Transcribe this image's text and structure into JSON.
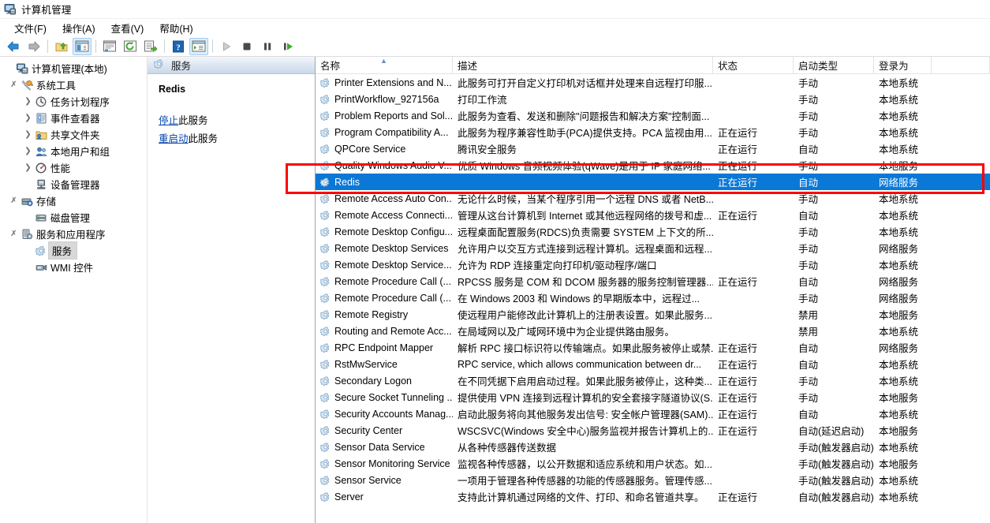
{
  "window": {
    "title": "计算机管理",
    "icon": "computer-management-icon"
  },
  "menu": {
    "items": [
      {
        "label": "文件(F)",
        "text": "文件",
        "accel": "F"
      },
      {
        "label": "操作(A)",
        "text": "操作",
        "accel": "A"
      },
      {
        "label": "查看(V)",
        "text": "查看",
        "accel": "V"
      },
      {
        "label": "帮助(H)",
        "text": "帮助",
        "accel": "H"
      }
    ]
  },
  "toolbar": {
    "buttons": [
      {
        "name": "back-icon",
        "title": "后退"
      },
      {
        "name": "forward-icon",
        "title": "前进"
      },
      {
        "name": "up-folder-icon",
        "title": "上移一级"
      },
      {
        "name": "show-hide-tree-icon",
        "title": "显示/隐藏控制台树",
        "active": true
      },
      {
        "name": "properties-icon",
        "title": "属性"
      },
      {
        "name": "refresh-icon",
        "title": "刷新"
      },
      {
        "name": "export-list-icon",
        "title": "导出列表"
      },
      {
        "name": "help-icon",
        "title": "帮助"
      },
      {
        "name": "show-action-pane-icon",
        "title": "显示/隐藏操作窗格",
        "active": true
      },
      {
        "name": "start-service-icon",
        "title": "启动服务"
      },
      {
        "name": "stop-service-icon",
        "title": "停止服务"
      },
      {
        "name": "pause-service-icon",
        "title": "暂停服务"
      },
      {
        "name": "restart-service-icon",
        "title": "重新启动服务"
      }
    ]
  },
  "sidebar": {
    "items": [
      {
        "label": "计算机管理(本地)",
        "depth": 0,
        "twist": "",
        "icon": "computer-icon",
        "selected": false
      },
      {
        "label": "系统工具",
        "depth": 1,
        "twist": "v",
        "icon": "system-tools-icon",
        "selected": false
      },
      {
        "label": "任务计划程序",
        "depth": 2,
        "twist": ">",
        "icon": "task-scheduler-icon",
        "selected": false
      },
      {
        "label": "事件查看器",
        "depth": 2,
        "twist": ">",
        "icon": "event-viewer-icon",
        "selected": false
      },
      {
        "label": "共享文件夹",
        "depth": 2,
        "twist": ">",
        "icon": "shared-folders-icon",
        "selected": false
      },
      {
        "label": "本地用户和组",
        "depth": 2,
        "twist": ">",
        "icon": "local-users-icon",
        "selected": false
      },
      {
        "label": "性能",
        "depth": 2,
        "twist": ">",
        "icon": "performance-icon",
        "selected": false
      },
      {
        "label": "设备管理器",
        "depth": 2,
        "twist": "",
        "icon": "device-manager-icon",
        "selected": false
      },
      {
        "label": "存储",
        "depth": 1,
        "twist": "v",
        "icon": "storage-icon",
        "selected": false
      },
      {
        "label": "磁盘管理",
        "depth": 2,
        "twist": "",
        "icon": "disk-management-icon",
        "selected": false
      },
      {
        "label": "服务和应用程序",
        "depth": 1,
        "twist": "v",
        "icon": "services-apps-icon",
        "selected": false
      },
      {
        "label": "服务",
        "depth": 2,
        "twist": "",
        "icon": "service-gear-icon",
        "selected": true
      },
      {
        "label": "WMI 控件",
        "depth": 2,
        "twist": "",
        "icon": "wmi-control-icon",
        "selected": false
      }
    ]
  },
  "details": {
    "header_title": "服务",
    "header_icon": "service-gear-icon",
    "service_name": "Redis",
    "links": [
      {
        "link_text": "停止",
        "rest_text": "此服务"
      },
      {
        "link_text": "重启动",
        "rest_text": "此服务"
      }
    ]
  },
  "list": {
    "columns": [
      {
        "key": "name",
        "label": "名称",
        "sorted": true,
        "sort_dir": "asc"
      },
      {
        "key": "desc",
        "label": "描述",
        "sorted": false
      },
      {
        "key": "status",
        "label": "状态",
        "sorted": false
      },
      {
        "key": "start",
        "label": "启动类型",
        "sorted": false
      },
      {
        "key": "logon",
        "label": "登录为",
        "sorted": false
      }
    ],
    "rows": [
      {
        "name": "Printer Extensions and N...",
        "desc": "此服务可打开自定义打印机对话框并处理来自远程打印服...",
        "status": "",
        "start": "手动",
        "logon": "本地系统",
        "selected": false
      },
      {
        "name": "PrintWorkflow_927156a",
        "desc": "打印工作流",
        "status": "",
        "start": "手动",
        "logon": "本地系统",
        "selected": false
      },
      {
        "name": "Problem Reports and Sol...",
        "desc": "此服务为查看、发送和删除\"问题报告和解决方案\"控制面...",
        "status": "",
        "start": "手动",
        "logon": "本地系统",
        "selected": false
      },
      {
        "name": "Program Compatibility A...",
        "desc": "此服务为程序兼容性助手(PCA)提供支持。PCA 监视由用...",
        "status": "正在运行",
        "start": "手动",
        "logon": "本地系统",
        "selected": false
      },
      {
        "name": "QPCore Service",
        "desc": "腾讯安全服务",
        "status": "正在运行",
        "start": "自动",
        "logon": "本地系统",
        "selected": false
      },
      {
        "name": "Quality Windows Audio V...",
        "desc": "优质 Windows 音频视频体验(qWave)是用于 IP 家庭网络...",
        "status": "正在运行",
        "start": "手动",
        "logon": "本地服务",
        "selected": false
      },
      {
        "name": "Redis",
        "desc": "",
        "status": "正在运行",
        "start": "自动",
        "logon": "网络服务",
        "selected": true
      },
      {
        "name": "Remote Access Auto Con...",
        "desc": "无论什么时候，当某个程序引用一个远程 DNS 或者 NetB...",
        "status": "",
        "start": "手动",
        "logon": "本地系统",
        "selected": false
      },
      {
        "name": "Remote Access Connecti...",
        "desc": "管理从这台计算机到 Internet 或其他远程网络的拨号和虚...",
        "status": "正在运行",
        "start": "自动",
        "logon": "本地系统",
        "selected": false
      },
      {
        "name": "Remote Desktop Configu...",
        "desc": "远程桌面配置服务(RDCS)负责需要 SYSTEM 上下文的所...",
        "status": "",
        "start": "手动",
        "logon": "本地系统",
        "selected": false
      },
      {
        "name": "Remote Desktop Services",
        "desc": "允许用户以交互方式连接到远程计算机。远程桌面和远程...",
        "status": "",
        "start": "手动",
        "logon": "网络服务",
        "selected": false
      },
      {
        "name": "Remote Desktop Service...",
        "desc": "允许为 RDP 连接重定向打印机/驱动程序/端口",
        "status": "",
        "start": "手动",
        "logon": "本地系统",
        "selected": false
      },
      {
        "name": "Remote Procedure Call (...",
        "desc": "RPCSS 服务是 COM 和 DCOM 服务器的服务控制管理器...",
        "status": "正在运行",
        "start": "自动",
        "logon": "网络服务",
        "selected": false
      },
      {
        "name": "Remote Procedure Call (...",
        "desc": "在 Windows 2003 和 Windows 的早期版本中，远程过...",
        "status": "",
        "start": "手动",
        "logon": "网络服务",
        "selected": false
      },
      {
        "name": "Remote Registry",
        "desc": "使远程用户能修改此计算机上的注册表设置。如果此服务...",
        "status": "",
        "start": "禁用",
        "logon": "本地服务",
        "selected": false
      },
      {
        "name": "Routing and Remote Acc...",
        "desc": "在局域网以及广域网环境中为企业提供路由服务。",
        "status": "",
        "start": "禁用",
        "logon": "本地系统",
        "selected": false
      },
      {
        "name": "RPC Endpoint Mapper",
        "desc": "解析 RPC 接口标识符以传输端点。如果此服务被停止或禁...",
        "status": "正在运行",
        "start": "自动",
        "logon": "网络服务",
        "selected": false
      },
      {
        "name": "RstMwService",
        "desc": "RPC service, which allows communication between dr...",
        "status": "正在运行",
        "start": "自动",
        "logon": "本地系统",
        "selected": false
      },
      {
        "name": "Secondary Logon",
        "desc": "在不同凭据下启用启动过程。如果此服务被停止，这种类...",
        "status": "正在运行",
        "start": "手动",
        "logon": "本地系统",
        "selected": false
      },
      {
        "name": "Secure Socket Tunneling ...",
        "desc": "提供使用 VPN 连接到远程计算机的安全套接字隧道协议(S...",
        "status": "正在运行",
        "start": "手动",
        "logon": "本地服务",
        "selected": false
      },
      {
        "name": "Security Accounts Manag...",
        "desc": "启动此服务将向其他服务发出信号: 安全帐户管理器(SAM)...",
        "status": "正在运行",
        "start": "自动",
        "logon": "本地系统",
        "selected": false
      },
      {
        "name": "Security Center",
        "desc": "WSCSVC(Windows 安全中心)服务监视并报告计算机上的...",
        "status": "正在运行",
        "start": "自动(延迟启动)",
        "logon": "本地服务",
        "selected": false
      },
      {
        "name": "Sensor Data Service",
        "desc": "从各种传感器传送数据",
        "status": "",
        "start": "手动(触发器启动)",
        "logon": "本地系统",
        "selected": false
      },
      {
        "name": "Sensor Monitoring Service",
        "desc": "监视各种传感器，以公开数据和适应系统和用户状态。如...",
        "status": "",
        "start": "手动(触发器启动)",
        "logon": "本地服务",
        "selected": false
      },
      {
        "name": "Sensor Service",
        "desc": "一项用于管理各种传感器的功能的传感器服务。管理传感...",
        "status": "",
        "start": "手动(触发器启动)",
        "logon": "本地系统",
        "selected": false
      },
      {
        "name": "Server",
        "desc": "支持此计算机通过网络的文件、打印、和命名管道共享。",
        "status": "正在运行",
        "start": "自动(触发器启动)",
        "logon": "本地系统",
        "selected": false
      }
    ]
  },
  "annotation": {
    "type": "red-rectangle-highlight",
    "color": "#ff0000",
    "target_row": "Redis"
  }
}
